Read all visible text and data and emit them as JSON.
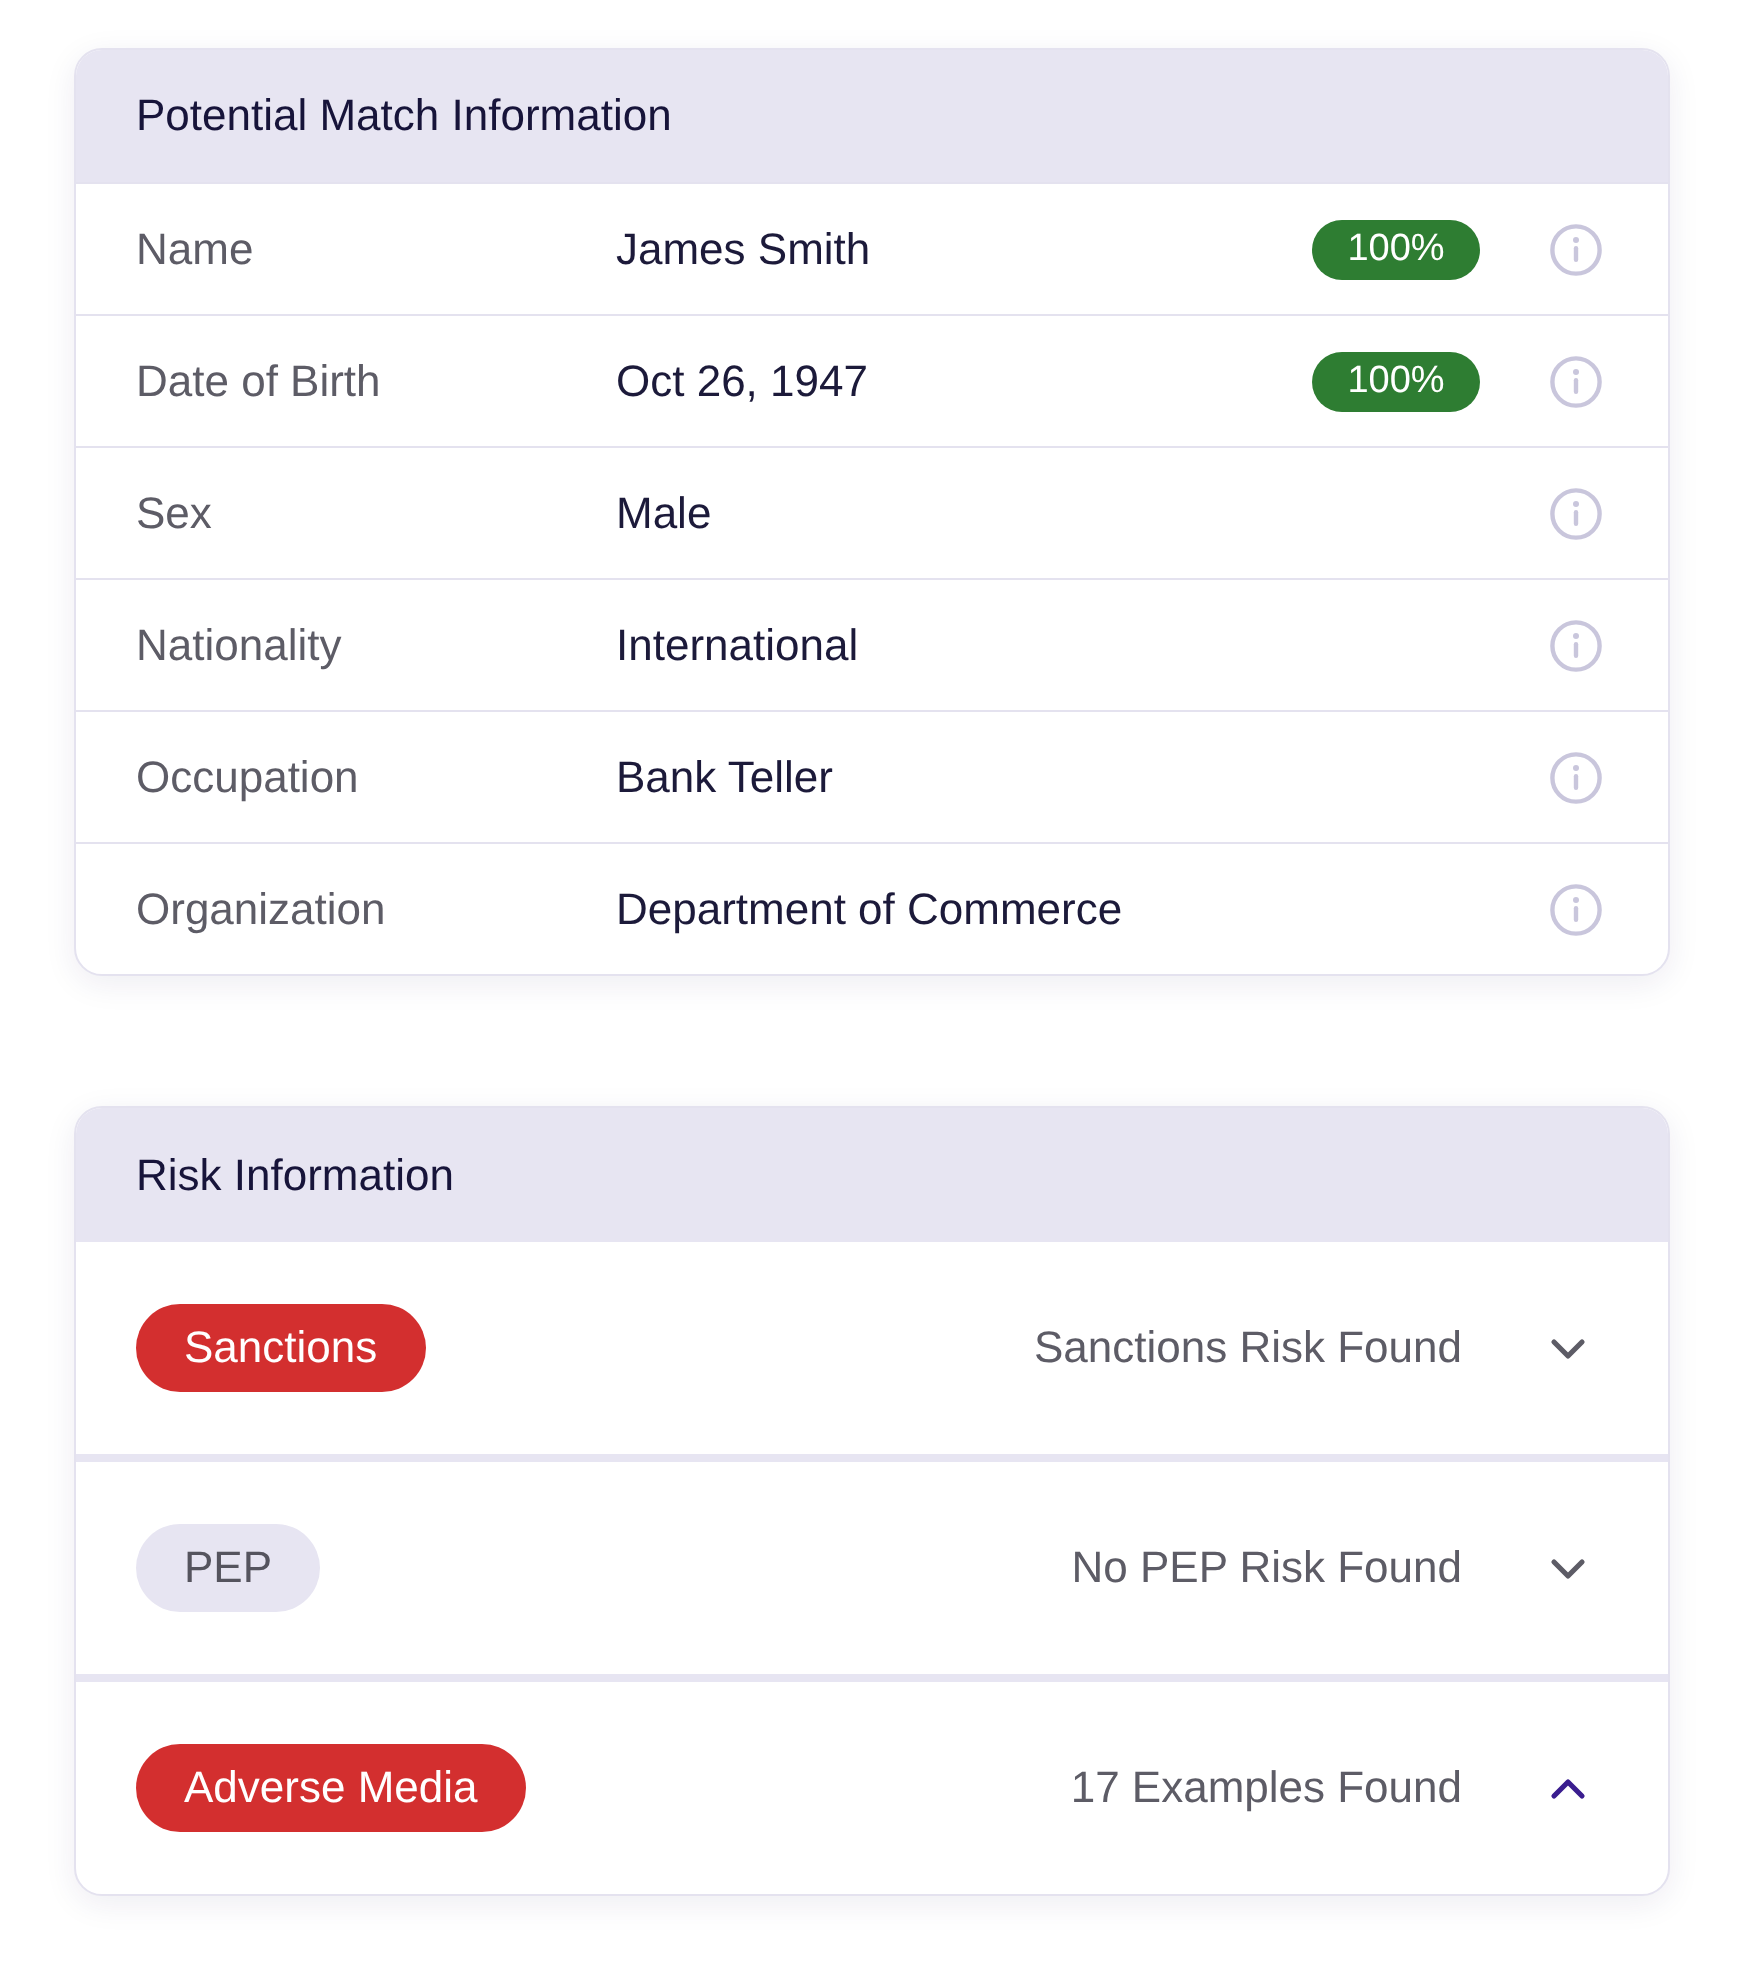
{
  "match_card": {
    "title": "Potential Match Information",
    "rows": [
      {
        "label": "Name",
        "value": "James Smith",
        "score": "100%"
      },
      {
        "label": "Date of Birth",
        "value": "Oct 26, 1947",
        "score": "100%"
      },
      {
        "label": "Sex",
        "value": "Male"
      },
      {
        "label": "Nationality",
        "value": "International"
      },
      {
        "label": "Occupation",
        "value": "Bank Teller"
      },
      {
        "label": "Organization",
        "value": "Department of Commerce"
      }
    ]
  },
  "risk_card": {
    "title": "Risk Information",
    "risks": [
      {
        "tag": "Sanctions",
        "flagged": true,
        "status": "Sanctions Risk Found",
        "expanded": false
      },
      {
        "tag": "PEP",
        "flagged": false,
        "status": "No PEP Risk Found",
        "expanded": false
      },
      {
        "tag": "Adverse Media",
        "flagged": true,
        "status": "17 Examples Found",
        "expanded": true
      }
    ]
  }
}
